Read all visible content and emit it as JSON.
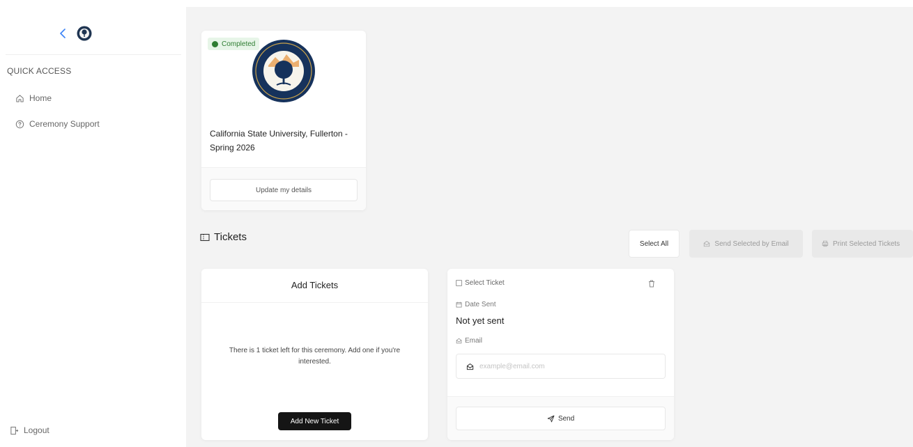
{
  "sidebar": {
    "quick_access_title": "QUICK ACCESS",
    "items": [
      {
        "label": "Home",
        "icon": "home-icon"
      },
      {
        "label": "Ceremony Support",
        "icon": "help-circle-icon"
      }
    ],
    "logout_label": "Logout"
  },
  "ceremony": {
    "status": "Completed",
    "name": "California State University, Fullerton - Spring 2026",
    "update_button": "Update my details"
  },
  "tickets": {
    "heading": "Tickets",
    "select_all": "Select All",
    "send_selected": "Send Selected by Email",
    "print_selected": "Print Selected Tickets",
    "add_card": {
      "title": "Add Tickets",
      "message": "There is 1 ticket left for this ceremony. Add one if you're interested.",
      "button": "Add New Ticket"
    },
    "ticket": {
      "select_label": "Select Ticket",
      "date_label": "Date Sent",
      "date_value": "Not yet sent",
      "email_label": "Email",
      "email_placeholder": "example@email.com",
      "email_value": "",
      "send_button": "Send"
    }
  },
  "colors": {
    "accent": "#1a3a6b",
    "status_green": "#2e7d32",
    "dark_button": "#151515"
  }
}
